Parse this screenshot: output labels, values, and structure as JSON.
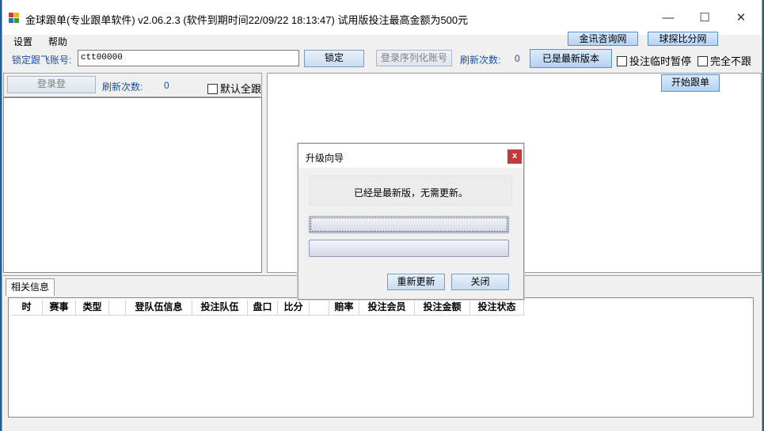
{
  "window": {
    "title": "金球跟单(专业跟单软件) v2.06.2.3 (软件到期时间22/09/22 18:13:47) 试用版投注最高金额为500元",
    "minimize_glyph": "—",
    "maximize_glyph": "☐",
    "close_glyph": "✕"
  },
  "menu": {
    "settings": "设置",
    "help": "帮助"
  },
  "links": {
    "jinxun": "金讯咨询网",
    "qiutan": "球探比分网"
  },
  "toolbar": {
    "lock_label": "锁定跟飞账号:",
    "account_value": "ctt00000",
    "lock_button": "锁定",
    "login_serial_button": "登录序列化账号",
    "refresh_label": "刷新次数:",
    "refresh_count": "0",
    "latest_version_button": "已是最新版本",
    "pause_betting": "投注临时暂停",
    "no_follow": "完全不跟"
  },
  "left_panel": {
    "login_button": "登录登",
    "refresh_label": "刷新次数:",
    "refresh_count": "0",
    "default_follow_all": "默认全跟"
  },
  "right_panel": {
    "start_follow_button": "开始跟单"
  },
  "dialog": {
    "title": "升级向导",
    "close_glyph": "x",
    "message": "已经是最新版，无需更新。",
    "progress_1": 0,
    "progress_2": 0,
    "reupdate_button": "重新更新",
    "close_button": "关闭"
  },
  "info": {
    "tab_label": "相关信息",
    "columns": [
      "时",
      "赛事",
      "类型",
      "",
      "登队伍信息",
      "投注队伍",
      "盘口",
      "比分",
      "",
      "赔率",
      "投注会员",
      "投注金额",
      "投注状态"
    ]
  }
}
